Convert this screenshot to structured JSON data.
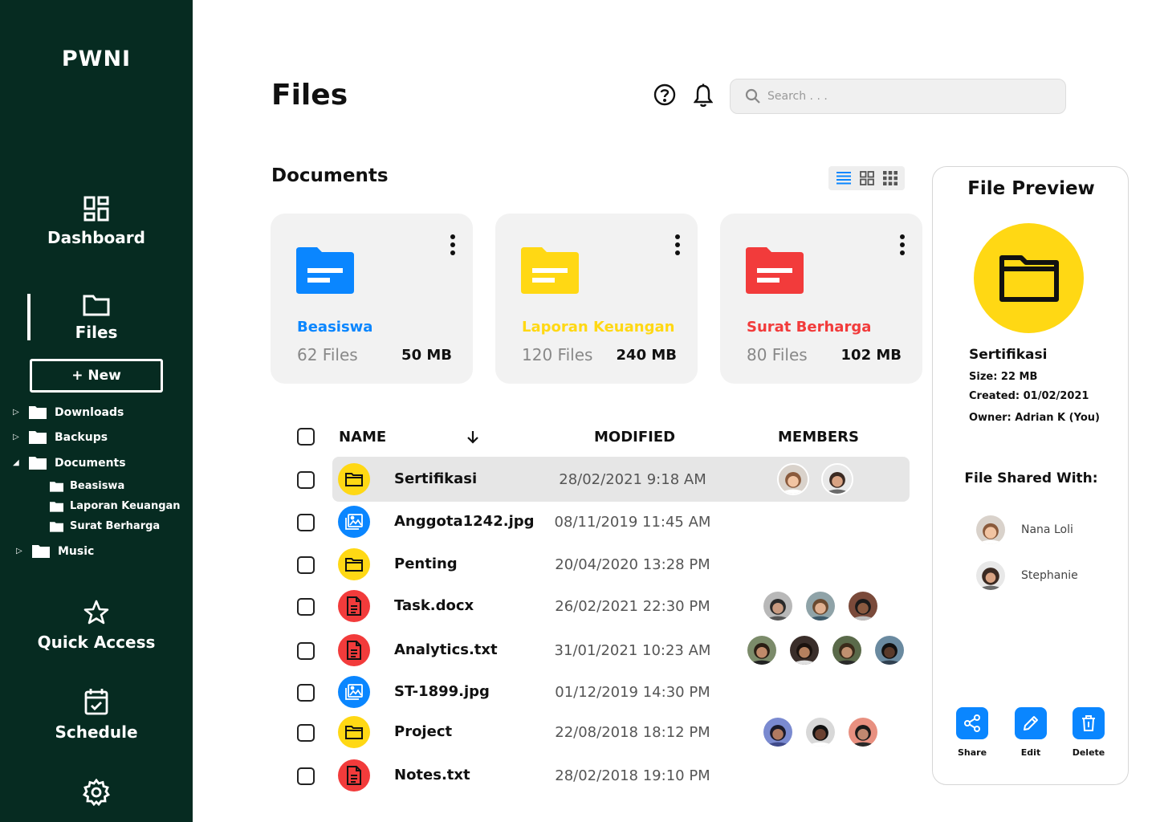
{
  "brand": "PWNI",
  "nav": {
    "dashboard": "Dashboard",
    "files": "Files",
    "quick_access": "Quick Access",
    "schedule": "Schedule"
  },
  "new_button": "+ New",
  "tree": {
    "downloads": "Downloads",
    "backups": "Backups",
    "documents": "Documents",
    "beasiswa": "Beasiswa",
    "laporan": "Laporan Keuangan",
    "surat": "Surat Berharga",
    "music": "Music"
  },
  "header": {
    "title": "Files",
    "search_placeholder": "Search . . ."
  },
  "section_title": "Documents",
  "folders": [
    {
      "name": "Beasiswa",
      "count": "62 Files",
      "size": "50 MB",
      "color": "#0a86ff"
    },
    {
      "name": "Laporan Keuangan",
      "count": "120 Files",
      "size": "240 MB",
      "color": "#ffd814"
    },
    {
      "name": "Surat Berharga",
      "count": "80 Files",
      "size": "102 MB",
      "color": "#f23b3b"
    }
  ],
  "table": {
    "col_name": "NAME",
    "col_modified": "MODIFIED",
    "col_members": "MEMBERS",
    "rows": [
      {
        "name": "Sertifikasi",
        "modified": "28/02/2021 9:18 AM",
        "type": "folder"
      },
      {
        "name": "Anggota1242.jpg",
        "modified": "08/11/2019 11:45 AM",
        "type": "image"
      },
      {
        "name": "Penting",
        "modified": "20/04/2020 13:28 PM",
        "type": "folder"
      },
      {
        "name": "Task.docx",
        "modified": "26/02/2021 22:30 PM",
        "type": "document"
      },
      {
        "name": "Analytics.txt",
        "modified": "31/01/2021 10:23 AM",
        "type": "document"
      },
      {
        "name": "ST-1899.jpg",
        "modified": "01/12/2019 14:30 PM",
        "type": "image"
      },
      {
        "name": "Project",
        "modified": "22/08/2018 18:12 PM",
        "type": "folder"
      },
      {
        "name": "Notes.txt",
        "modified": "28/02/2018 19:10 PM",
        "type": "document"
      }
    ]
  },
  "preview": {
    "title": "File Preview",
    "name": "Sertifikasi",
    "size": "Size: 22 MB",
    "created": "Created: 01/02/2021",
    "owner": "Owner: Adrian K (You)",
    "shared_title": "File Shared With:",
    "shared_users": [
      "Nana Loli",
      "Stephanie"
    ],
    "actions": {
      "share": "Share",
      "edit": "Edit",
      "delete": "Delete"
    }
  },
  "colors": {
    "sidebar": "#062b21",
    "accent_blue": "#0a86ff",
    "accent_yellow": "#ffd814",
    "accent_red": "#f23b3b"
  }
}
